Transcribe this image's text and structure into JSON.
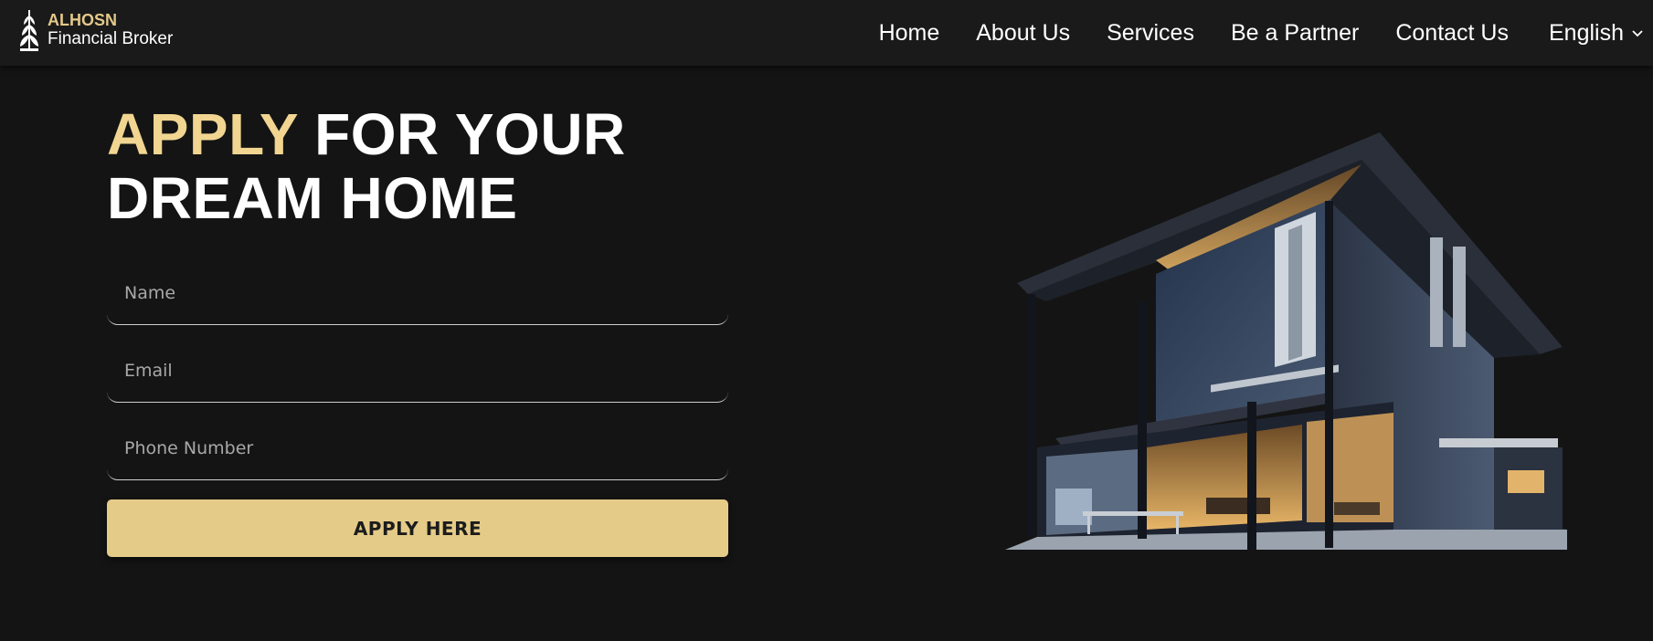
{
  "header": {
    "logo": {
      "brand": "ALHOSN",
      "subtitle": "Financial Broker",
      "icon": "wheat-stalk-logo-icon"
    },
    "nav": [
      {
        "label": "Home"
      },
      {
        "label": "About Us"
      },
      {
        "label": "Services"
      },
      {
        "label": "Be a Partner"
      },
      {
        "label": "Contact Us"
      }
    ],
    "language": {
      "label": "English",
      "icon": "chevron-down-icon"
    }
  },
  "hero": {
    "title_accent": "APPLY",
    "title_rest_line1": "FOR YOUR",
    "title_line2": "DREAM HOME",
    "image": "modern-house-image"
  },
  "form": {
    "name_placeholder": "Name",
    "email_placeholder": "Email",
    "phone_placeholder": "Phone Number",
    "submit_label": "APPLY HERE"
  },
  "colors": {
    "background": "#141414",
    "header_bg": "#1a1a1a",
    "accent_gold": "#e5c98a",
    "button_gold": "#e5cb88",
    "text": "#ffffff"
  }
}
